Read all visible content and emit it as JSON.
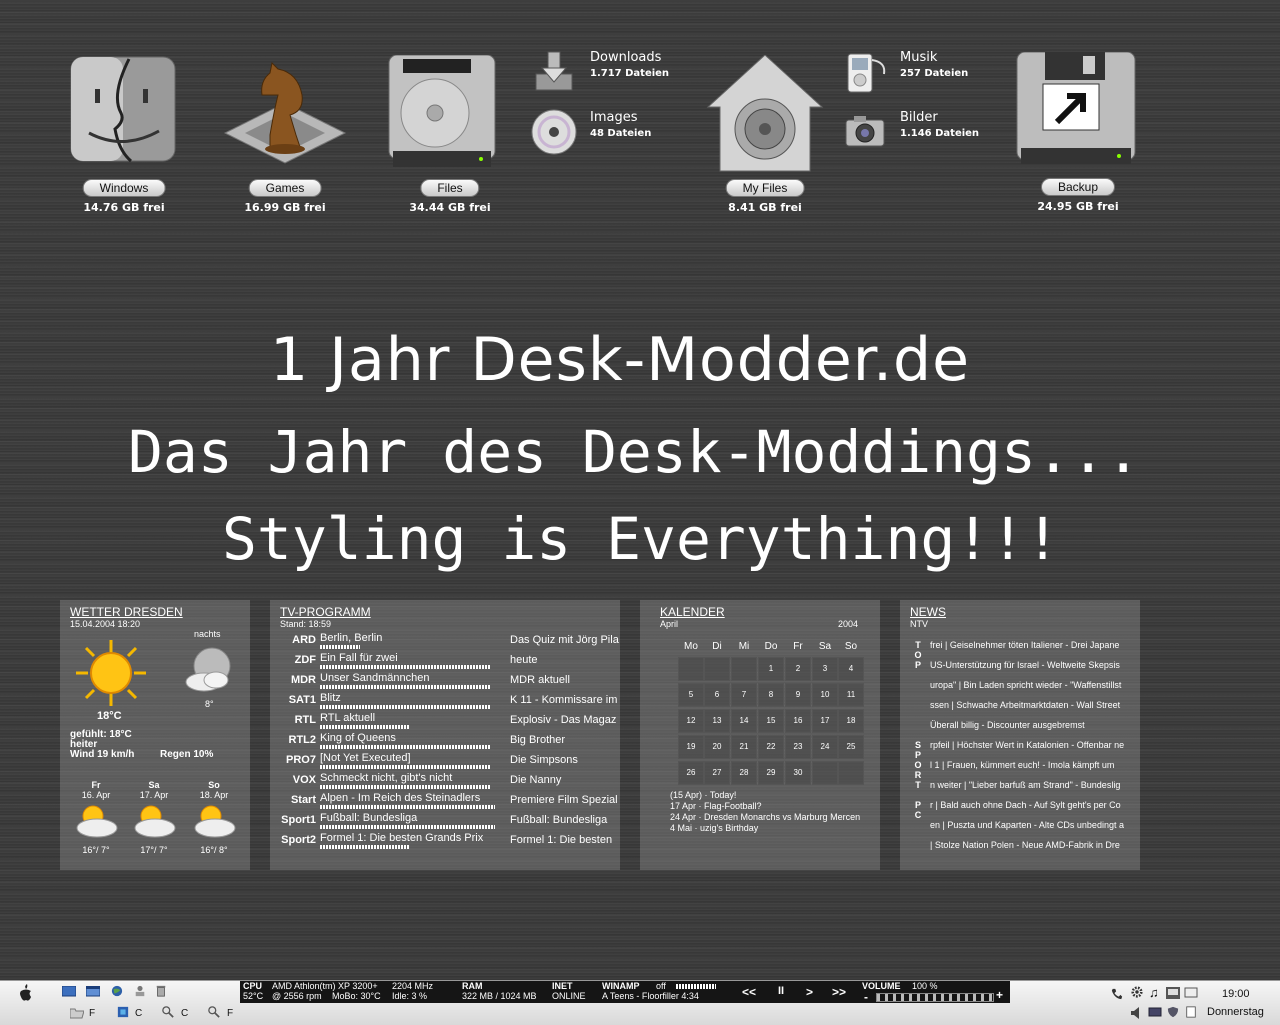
{
  "desktop": {
    "drives": [
      {
        "label": "Windows",
        "free": "14.76 GB frei",
        "icon": "finder-icon"
      },
      {
        "label": "Games",
        "free": "16.99 GB frei",
        "icon": "chess-knight-icon"
      },
      {
        "label": "Files",
        "free": "34.44 GB frei",
        "icon": "hard-drive-icon"
      },
      {
        "label": "My Files",
        "free": "8.41 GB frei",
        "icon": "home-vault-icon"
      },
      {
        "label": "Backup",
        "free": "24.95 GB frei",
        "icon": "floppy-drive-icon"
      }
    ],
    "folders": [
      {
        "name": "Downloads",
        "count": "1.717 Dateien",
        "icon": "download-tray-icon"
      },
      {
        "name": "Images",
        "count": "48 Dateien",
        "icon": "cd-disc-icon"
      },
      {
        "name": "Musik",
        "count": "257 Dateien",
        "icon": "ipod-icon"
      },
      {
        "name": "Bilder",
        "count": "1.146 Dateien",
        "icon": "camera-icon"
      }
    ]
  },
  "headline": {
    "line1": "1 Jahr Desk-Modder.de",
    "line2": "Das Jahr des Desk-Moddings...",
    "line3": "Styling is Everything!!!"
  },
  "weather": {
    "title": "WETTER DRESDEN",
    "stamp": "15.04.2004 18:20",
    "night_label": "nachts",
    "temp": "18°C",
    "night_temp": "8°",
    "felt": "gefühlt: 18°C",
    "condition": "heiter",
    "wind": "Wind  19 km/h",
    "rain": "Regen  10%",
    "forecast": [
      {
        "day": "Fr",
        "date": "16. Apr",
        "range": "16°/ 7°"
      },
      {
        "day": "Sa",
        "date": "17. Apr",
        "range": "17°/ 7°"
      },
      {
        "day": "So",
        "date": "18. Apr",
        "range": "16°/ 8°"
      }
    ]
  },
  "tv": {
    "title": "TV-PROGRAMM",
    "stand": "Stand: 18:59",
    "rows": [
      {
        "ch": "ARD",
        "now": "Berlin, Berlin",
        "next": "Das Quiz mit Jörg Pila",
        "progress": 0.22
      },
      {
        "ch": "ZDF",
        "now": "Ein Fall für zwei",
        "next": "heute",
        "progress": 0.95
      },
      {
        "ch": "MDR",
        "now": "Unser Sandmännchen",
        "next": "MDR aktuell",
        "progress": 0.95
      },
      {
        "ch": "SAT1",
        "now": "Blitz",
        "next": "K 11 - Kommissare im",
        "progress": 0.95
      },
      {
        "ch": "RTL",
        "now": "RTL aktuell",
        "next": "Explosiv - Das Magaz",
        "progress": 0.5
      },
      {
        "ch": "RTL2",
        "now": "King of Queens",
        "next": "Big Brother",
        "progress": 0.95
      },
      {
        "ch": "PRO7",
        "now": "[Not Yet Executed]",
        "next": "Die Simpsons",
        "progress": 0.95
      },
      {
        "ch": "VOX",
        "now": "Schmeckt nicht, gibt's nicht",
        "next": "Die Nanny",
        "progress": 0.95
      },
      {
        "ch": "Start",
        "now": "Alpen - Im Reich des Steinadlers",
        "next": "Premiere Film Spezial",
        "progress": 0.97
      },
      {
        "ch": "Sport1",
        "now": "Fußball: Bundesliga",
        "next": "Fußball: Bundesliga",
        "progress": 0.97
      },
      {
        "ch": "Sport2",
        "now": "Formel 1: Die besten Grands Prix",
        "next": "Formel 1: Die besten",
        "progress": 0.5
      }
    ]
  },
  "calendar": {
    "title": "KALENDER",
    "month": "April",
    "year": "2004",
    "weekdays": [
      "Mo",
      "Di",
      "Mi",
      "Do",
      "Fr",
      "Sa",
      "So"
    ],
    "cells": [
      "",
      "",
      "",
      "1",
      "2",
      "3",
      "4",
      "5",
      "6",
      "7",
      "8",
      "9",
      "10",
      "11",
      "12",
      "13",
      "14",
      "15",
      "16",
      "17",
      "18",
      "19",
      "20",
      "21",
      "22",
      "23",
      "24",
      "25",
      "26",
      "27",
      "28",
      "29",
      "30",
      "",
      ""
    ],
    "events": [
      "(15 Apr) · Today!",
      "17 Apr · Flag-Football?",
      "24 Apr · Dresden Monarchs vs Marburg Mercen",
      "4 Mai · uzig's Birthday"
    ]
  },
  "news": {
    "title": "NEWS",
    "source": "NTV",
    "sections": [
      "TOP",
      "SPORT",
      "PC"
    ],
    "items": [
      "frei | Geiselnehmer töten Italiener - Drei Japane",
      "US-Unterstützung für Israel - Weltweite Skepsis",
      "uropa\" | Bin Laden spricht wieder - \"Waffenstillst",
      "ssen | Schwache Arbeitmarktdaten - Wall Street",
      "Überall billig - Discounter ausgebremst",
      "rpfeil | Höchster Wert in Katalonien - Offenbar ne",
      "l 1 | Frauen, kümmert euch! - Imola kämpft um",
      "n weiter | \"Lieber barfuß am Strand\" - Bundeslig",
      "r | Bald auch ohne Dach - Auf Sylt geht's per Co",
      "en | Puszta und Kaparten - Alte CDs unbedingt a",
      "| Stolze Nation Polen - Neue AMD-Fabrik in Dre"
    ]
  },
  "taskbar": {
    "cpu_label": "CPU",
    "cpu_name": "AMD Athlon(tm) XP 3200+",
    "cpu_mhz": "2204 MHz",
    "cpu_temp": "52°C",
    "cpu_fan": "@ 2556 rpm",
    "mobo": "MoBo: 30°C",
    "idle": "Idle: 3 %",
    "ram_label": "RAM",
    "ram_val": "322 MB / 1024 MB",
    "inet_label": "INET",
    "inet_val": "ONLINE",
    "winamp_label": "WINAMP",
    "winamp_state": "off",
    "track": "A Teens - Floorfiller 4:34",
    "btn_prev": "<<",
    "btn_pause": "II",
    "btn_play": ">",
    "btn_next": ">>",
    "volume_label": "VOLUME",
    "volume_pct": "100 %",
    "volume_minus": "-",
    "volume_plus": "+",
    "volume_level": 1.0,
    "drive_f1": "F",
    "drive_c1": "C",
    "drive_c2": "C",
    "drive_f2": "F",
    "clock": "19:00",
    "weekday": "Donnerstag"
  }
}
